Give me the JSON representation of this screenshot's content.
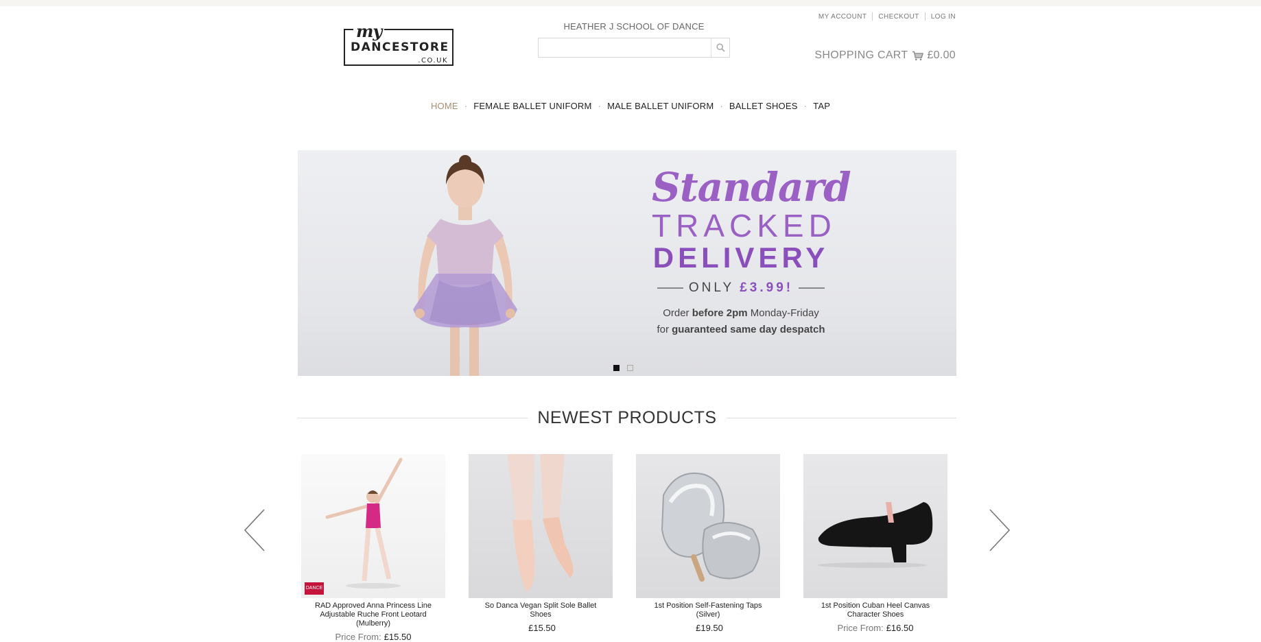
{
  "header": {
    "logo": {
      "script": "my",
      "name": "DANCESTORE",
      "tld": ".CO.UK"
    },
    "school_name": "HEATHER J SCHOOL OF DANCE",
    "search": {
      "placeholder": ""
    },
    "top_links": [
      "MY ACCOUNT",
      "CHECKOUT",
      "LOG IN"
    ],
    "cart": {
      "label": "SHOPPING CART",
      "total": "£0.00"
    }
  },
  "nav": {
    "items": [
      {
        "label": "HOME",
        "active": true
      },
      {
        "label": "FEMALE BALLET UNIFORM",
        "active": false
      },
      {
        "label": "MALE BALLET UNIFORM",
        "active": false
      },
      {
        "label": "BALLET SHOES",
        "active": false
      },
      {
        "label": "TAP",
        "active": false
      }
    ]
  },
  "hero": {
    "line1": "Standard",
    "line2": "TRACKED",
    "line3": "DELIVERY",
    "only": "ONLY",
    "price": "£3.99!",
    "sub1_pre": "Order ",
    "sub1_bold": "before 2pm",
    "sub1_post": " Monday-Friday",
    "sub2_pre": "for ",
    "sub2_bold": "guaranteed same day despatch",
    "slides": 2,
    "active_slide": 1
  },
  "newest": {
    "title": "NEWEST PRODUCTS",
    "products": [
      {
        "title": "RAD Approved Anna Princess Line Adjustable Ruche Front Leotard (Mulberry)",
        "price_prefix": "Price From:",
        "price": "£15.50",
        "badge": "DANCE"
      },
      {
        "title": "So Danca Vegan Split Sole Ballet Shoes",
        "price_prefix": "",
        "price": "£15.50"
      },
      {
        "title": "1st Position Self-Fastening Taps (Silver)",
        "price_prefix": "",
        "price": "£19.50"
      },
      {
        "title": "1st Position Cuban Heel Canvas Character Shoes",
        "price_prefix": "Price From:",
        "price": "£16.50"
      }
    ]
  },
  "colors": {
    "accent_nav": "#a78e70",
    "hero_purple": "#9a60c4"
  }
}
